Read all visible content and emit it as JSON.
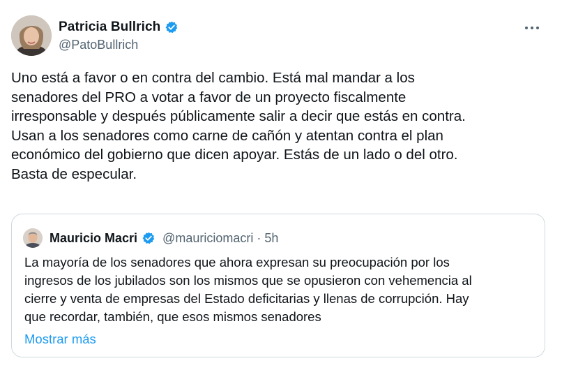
{
  "author": {
    "display_name": "Patricia Bullrich",
    "handle": "@PatoBullrich",
    "verified": true
  },
  "more_icon": "more-horizontal-icon",
  "tweet_text": "Uno está a favor o en contra del cambio. Está mal mandar a los\nsenadores del PRO a votar a favor de un proyecto fiscalmente\nirresponsable y después públicamente salir a decir que estás en contra.\nUsan a los senadores como carne de cañón y atentan contra el plan\neconómico del gobierno que dicen apoyar. Estás de un lado o del otro.\nBasta de especular.",
  "quoted": {
    "display_name": "Mauricio Macri",
    "handle_time": "@mauriciomacri · 5h",
    "verified": true,
    "text": "La mayoría de los senadores que ahora expresan su preocupación por los\ningresos de los jubilados son los mismos que se opusieron con vehemencia al\ncierre y venta de empresas del Estado deficitarias y llenas de corrupción. Hay\nque recordar, también, que esos mismos senadores",
    "show_more": "Mostrar más"
  },
  "colors": {
    "text": "#0f1419",
    "secondary": "#536471",
    "link": "#1d9bf0",
    "verified": "#1d9bf0",
    "border": "#cfd9de"
  }
}
